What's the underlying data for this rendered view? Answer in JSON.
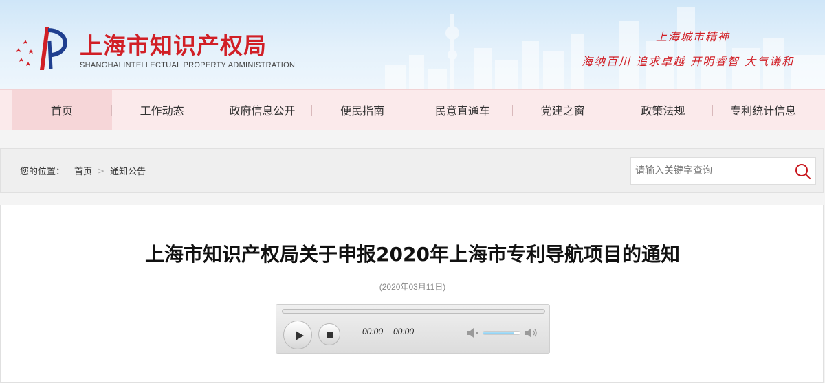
{
  "header": {
    "site_title": "上海市知识产权局",
    "site_subtitle": "SHANGHAI INTELLECTUAL PROPERTY ADMINISTRATION",
    "spirit_title": "上海城市精神",
    "spirit_line": "海纳百川  追求卓越  开明睿智  大气谦和",
    "brand_color": "#d11f26",
    "logo_icon": "sipa-logo-icon"
  },
  "nav": {
    "items": [
      {
        "label": "首页",
        "active": true
      },
      {
        "label": "工作动态"
      },
      {
        "label": "政府信息公开"
      },
      {
        "label": "便民指南"
      },
      {
        "label": "民意直通车"
      },
      {
        "label": "党建之窗"
      },
      {
        "label": "政策法规"
      },
      {
        "label": "专利统计信息"
      }
    ]
  },
  "breadcrumb": {
    "label": "您的位置：",
    "items": [
      "首页",
      "通知公告"
    ],
    "separator": ">"
  },
  "search": {
    "placeholder": "请输入关键字查询",
    "value": "",
    "icon": "search-icon"
  },
  "article": {
    "title": "上海市知识产权局关于申报2020年上海市专利导航项目的通知",
    "date": "(2020年03月11日)"
  },
  "player": {
    "current_time": "00:00",
    "total_time": "00:00",
    "progress": 0,
    "volume": 0.85
  }
}
